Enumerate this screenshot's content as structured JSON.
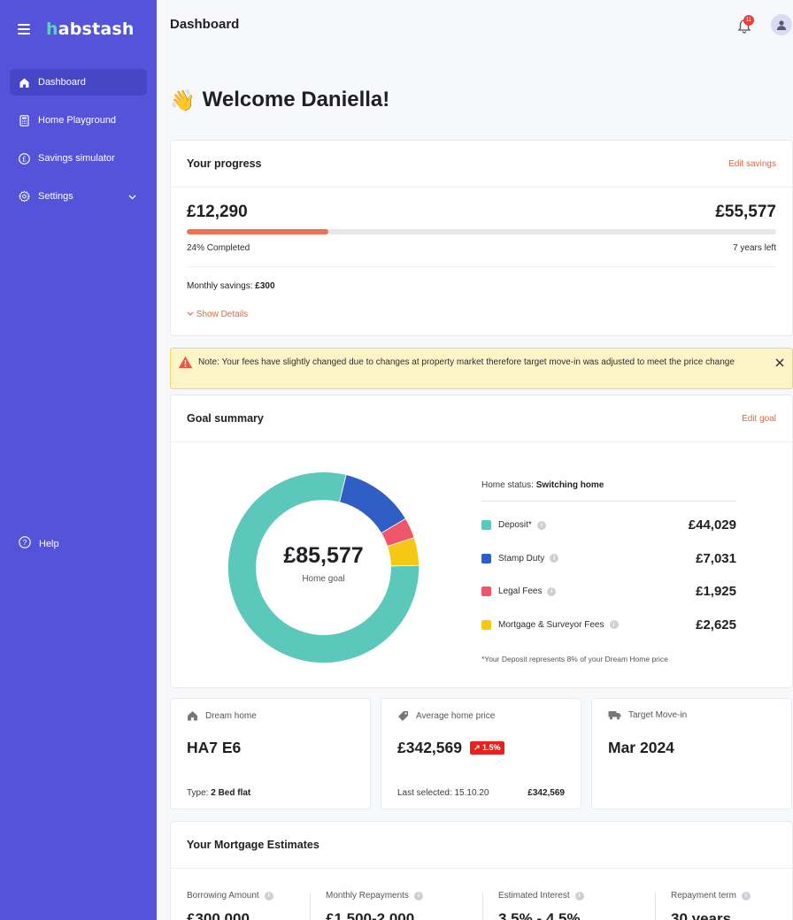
{
  "sidebar": {
    "logo_h": "h",
    "logo_rest": "abstash",
    "items": [
      {
        "label": "Dashboard",
        "icon": "home-icon"
      },
      {
        "label": "Home Playground",
        "icon": "calculator-icon"
      },
      {
        "label": "Savings simulator",
        "icon": "pound-icon"
      },
      {
        "label": "Settings",
        "icon": "gear-icon"
      }
    ],
    "help": "Help"
  },
  "header": {
    "title": "Dashboard",
    "notification_count": "11"
  },
  "welcome": {
    "emoji": "👋",
    "text": "Welcome Daniella!"
  },
  "progress": {
    "title": "Your progress",
    "edit_label": "Edit savings",
    "current": "£12,290",
    "target": "£55,577",
    "completed_fraction": 0.24,
    "completed_label": "24% Completed",
    "time_left": "7 years left",
    "monthly_label": "Monthly savings:",
    "monthly_value": "£300",
    "show_details": "Show Details"
  },
  "alert": {
    "text": "Note: Your fees have slightly changed due to changes at property market therefore target move-in was adjusted to meet the price change"
  },
  "goal": {
    "title": "Goal summary",
    "edit_label": "Edit goal",
    "total": "£85,577",
    "total_label": "Home goal",
    "status_label": "Home status:",
    "status_value": "Switching home",
    "items": [
      {
        "label": "Deposit*",
        "value": "£44,029",
        "amount": 44029,
        "color": "#5cc7bb"
      },
      {
        "label": "Stamp Duty",
        "value": "£7,031",
        "amount": 7031,
        "color": "#2f5ec4"
      },
      {
        "label": "Legal Fees",
        "value": "£1,925",
        "amount": 1925,
        "color": "#f0566a"
      },
      {
        "label": "Mortgage & Surveyor Fees",
        "value": "£2,625",
        "amount": 2625,
        "color": "#f6c814"
      }
    ],
    "footnote": "*Your Deposit represents 8% of your Dream Home price"
  },
  "stats": {
    "dream": {
      "label": "Dream home",
      "value": "HA7 E6",
      "foot_label": "Type:",
      "foot_value": "2 Bed flat"
    },
    "avg": {
      "label": "Average home price",
      "value": "£342,569",
      "badge": "↗ 1.5%",
      "foot_label": "Last selected: 15.10.20",
      "foot_value": "£342,569"
    },
    "movein": {
      "label": "Target Move-in",
      "value": "Mar 2024"
    }
  },
  "mortgage": {
    "title": "Your Mortgage Estimates",
    "cols": [
      {
        "label": "Borrowing Amount",
        "value": "£300,000"
      },
      {
        "label": "Monthly Repayments",
        "value": "£1,500-2,000"
      },
      {
        "label": "Estimated Interest",
        "value": "3.5% - 4.5%"
      },
      {
        "label": "Repayment term",
        "value": "30 years"
      }
    ]
  }
}
